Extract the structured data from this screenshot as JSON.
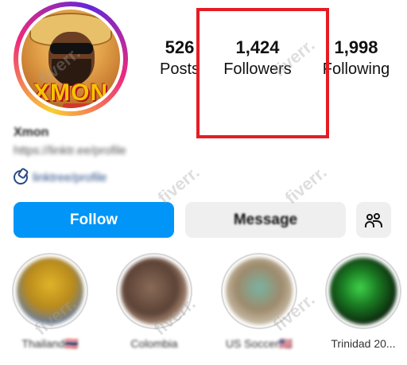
{
  "profile": {
    "avatar_text": "XMON",
    "name": "Xmon",
    "bio_line": "https://linktr.ee/profile",
    "link_text": "linktree/profile"
  },
  "stats": {
    "posts": {
      "value": "526",
      "label": "Posts"
    },
    "followers": {
      "value": "1,424",
      "label": "Followers"
    },
    "following": {
      "value": "1,998",
      "label": "Following"
    }
  },
  "buttons": {
    "follow": "Follow",
    "message": "Message",
    "suggest_icon": "add-people-icon"
  },
  "highlights": [
    {
      "label": "Thailand🇹🇭"
    },
    {
      "label": "Colombia"
    },
    {
      "label": "US Soccer🇺🇸"
    },
    {
      "label": "Trinidad 20..."
    }
  ],
  "watermark": "fiverr.",
  "colors": {
    "follow_button": "#0095f6",
    "highlight_box": "#e51c23"
  }
}
